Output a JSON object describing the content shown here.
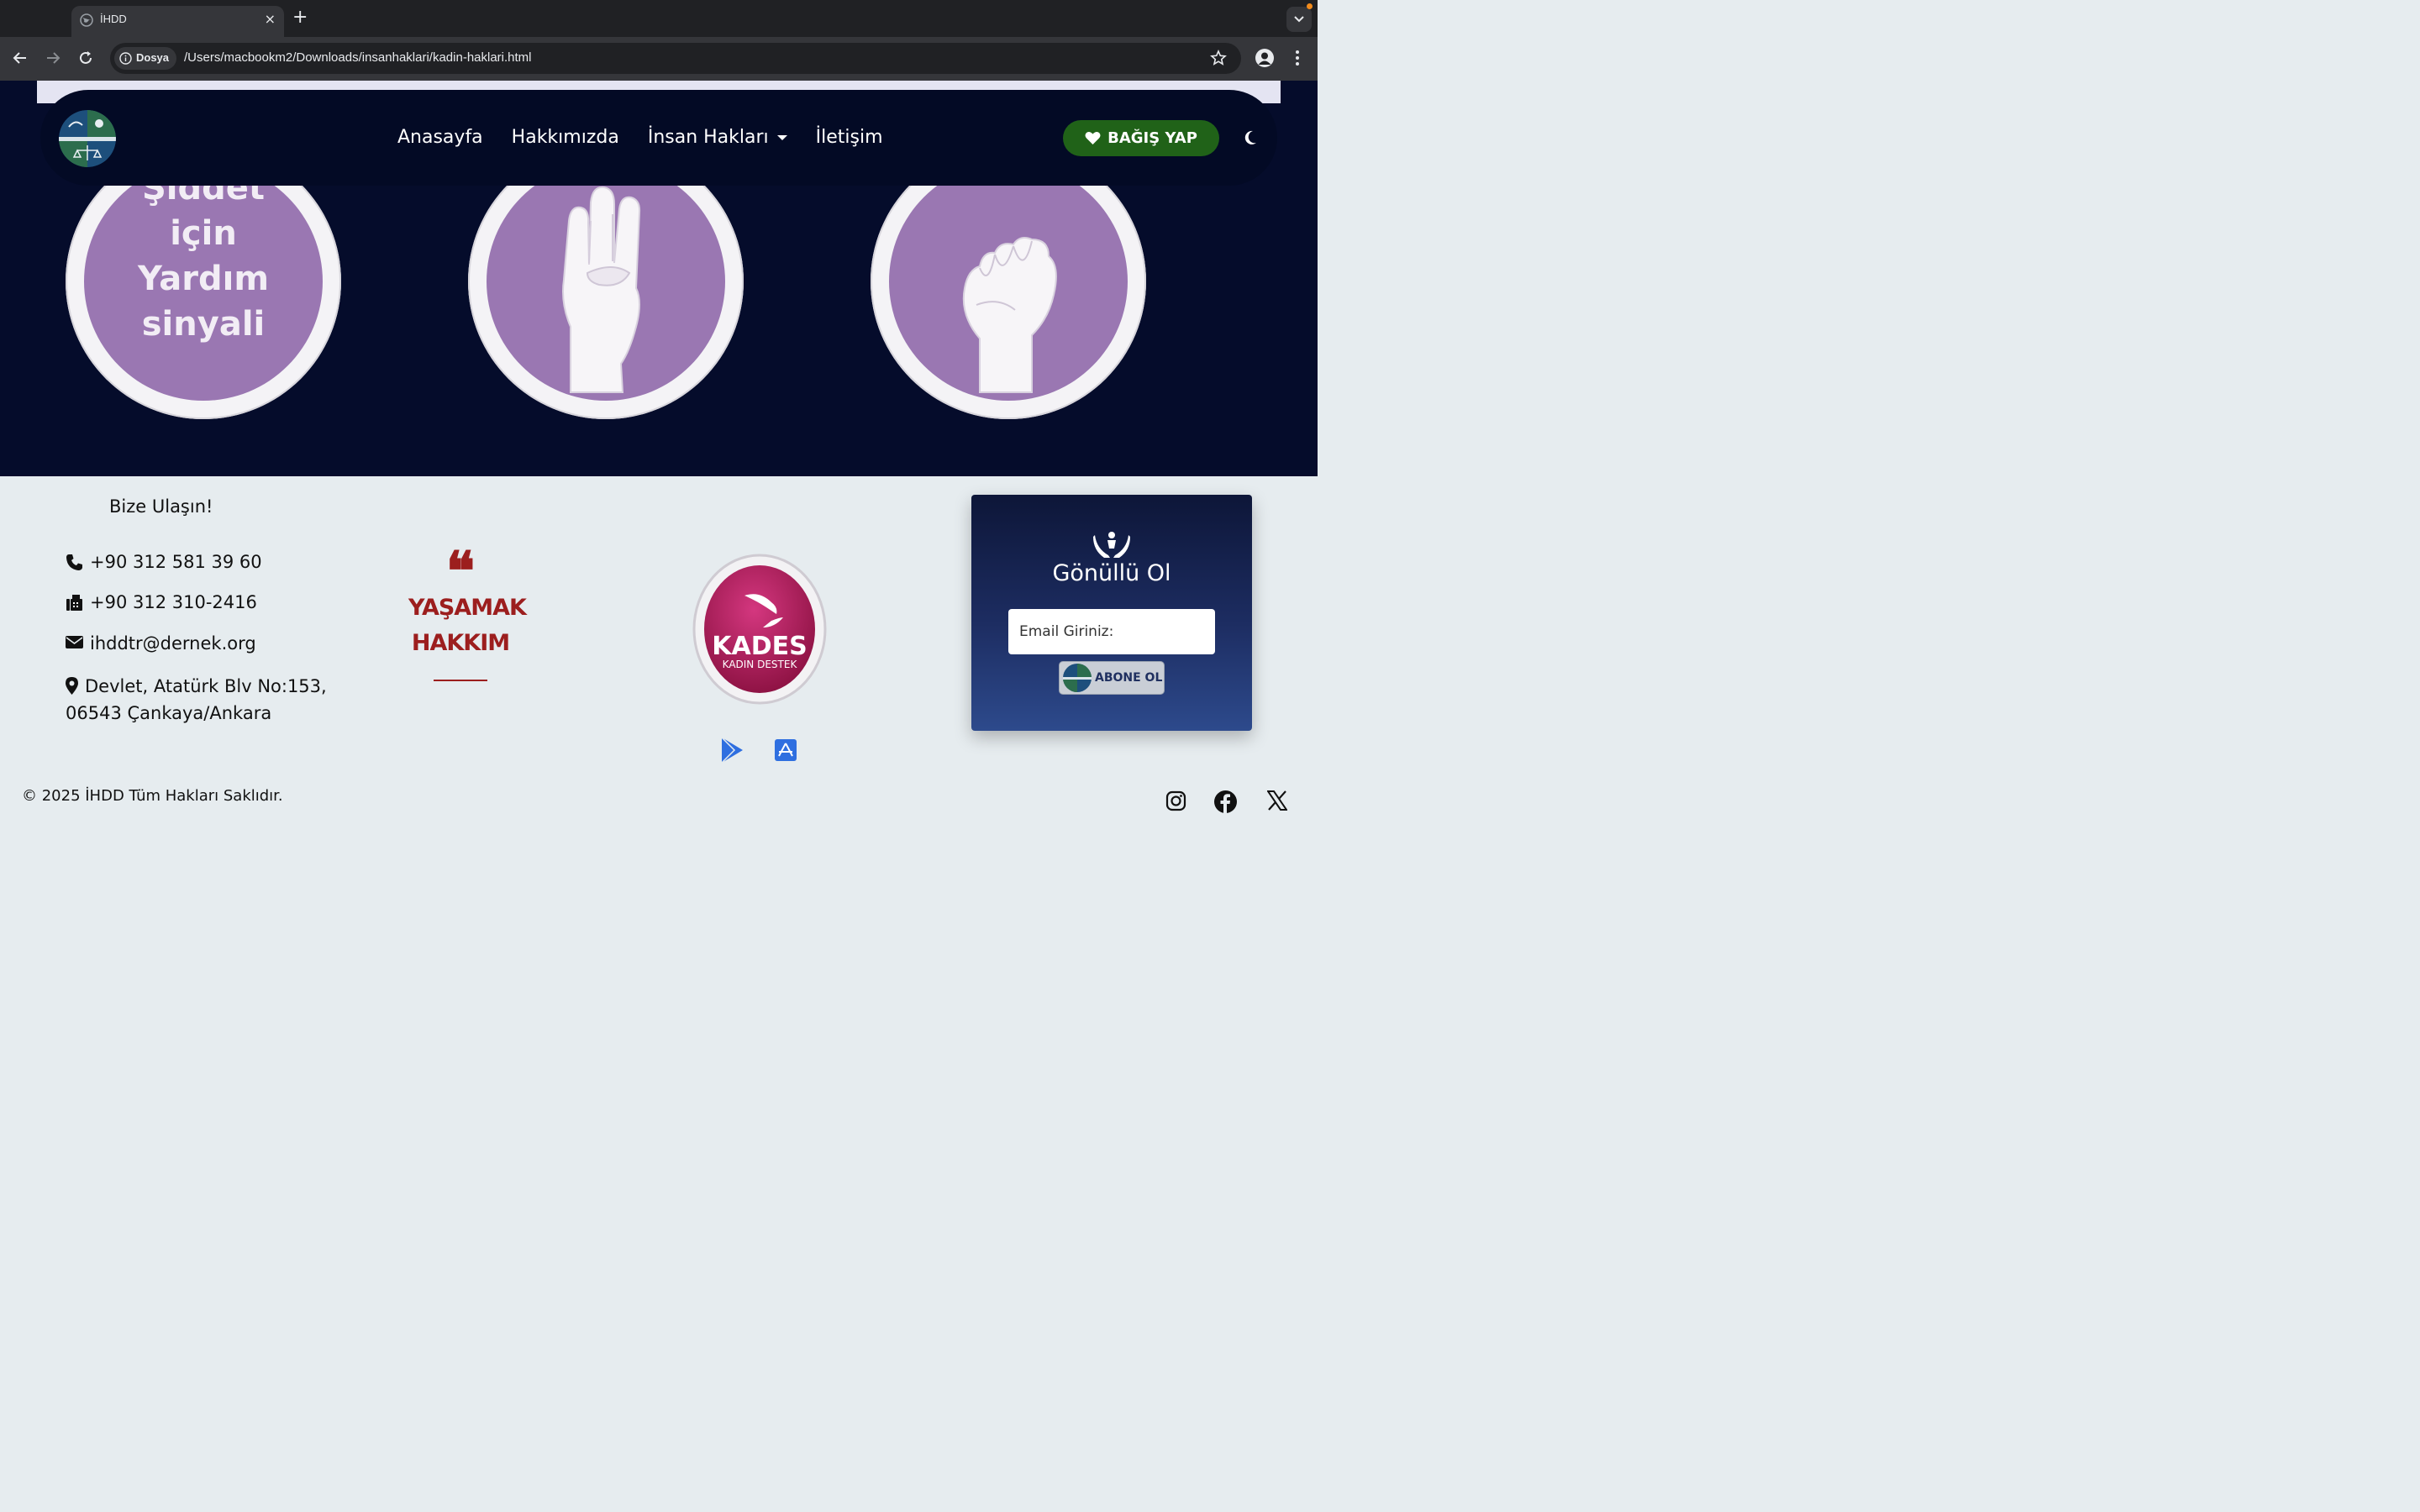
{
  "browser": {
    "tab_title": "İHDD",
    "tab_close": "×",
    "new_tab": "+",
    "security_chip": "Dosya",
    "url": "/Users/macbookm2/Downloads/insanhaklari/kadin-haklari.html"
  },
  "nav": {
    "items": [
      {
        "label": "Anasayfa"
      },
      {
        "label": "Hakkımızda"
      },
      {
        "label": "İnsan Hakları",
        "dropdown": true
      },
      {
        "label": "İletişim"
      }
    ],
    "donate_label": "BAĞIŞ YAP",
    "theme_icon": "moon-icon"
  },
  "hero": {
    "circles": [
      {
        "type": "text",
        "lines": [
          "Şiddet",
          "için",
          "Yardım",
          "sinyali"
        ]
      },
      {
        "type": "image",
        "icon": "open-hand-thumb-tucked-icon"
      },
      {
        "type": "image",
        "icon": "closed-fist-icon"
      }
    ],
    "circle_color": "#9a77b2"
  },
  "footer": {
    "contact_title": "Bize Ulaşın!",
    "phone": "+90 312 581 39 60",
    "fax": "+90 312 310-2416",
    "email": "ihddtr@dernek.org",
    "address_line1": "Devlet, Atatürk Blv No:153,",
    "address_line2": "06543 Çankaya/Ankara",
    "quote_mark": "❝",
    "quote_line1": "YAŞAMAK",
    "quote_line2": "HAKKIM",
    "kades_brand": "KADES",
    "kades_sub": "KADIN DESTEK",
    "volunteer_title": "Gönüllü Ol",
    "email_placeholder": "Email Giriniz:",
    "subscribe_label": "ABONE OL",
    "copyright": "© 2025 İHDD Tüm Hakları Saklıdır.",
    "social": [
      "instagram-icon",
      "facebook-icon",
      "x-icon"
    ]
  },
  "colors": {
    "hero_bg": "#050c2b",
    "donate_bg": "#206218",
    "quote_red": "#9c1e1e",
    "footer_bg": "#e6ecef"
  }
}
